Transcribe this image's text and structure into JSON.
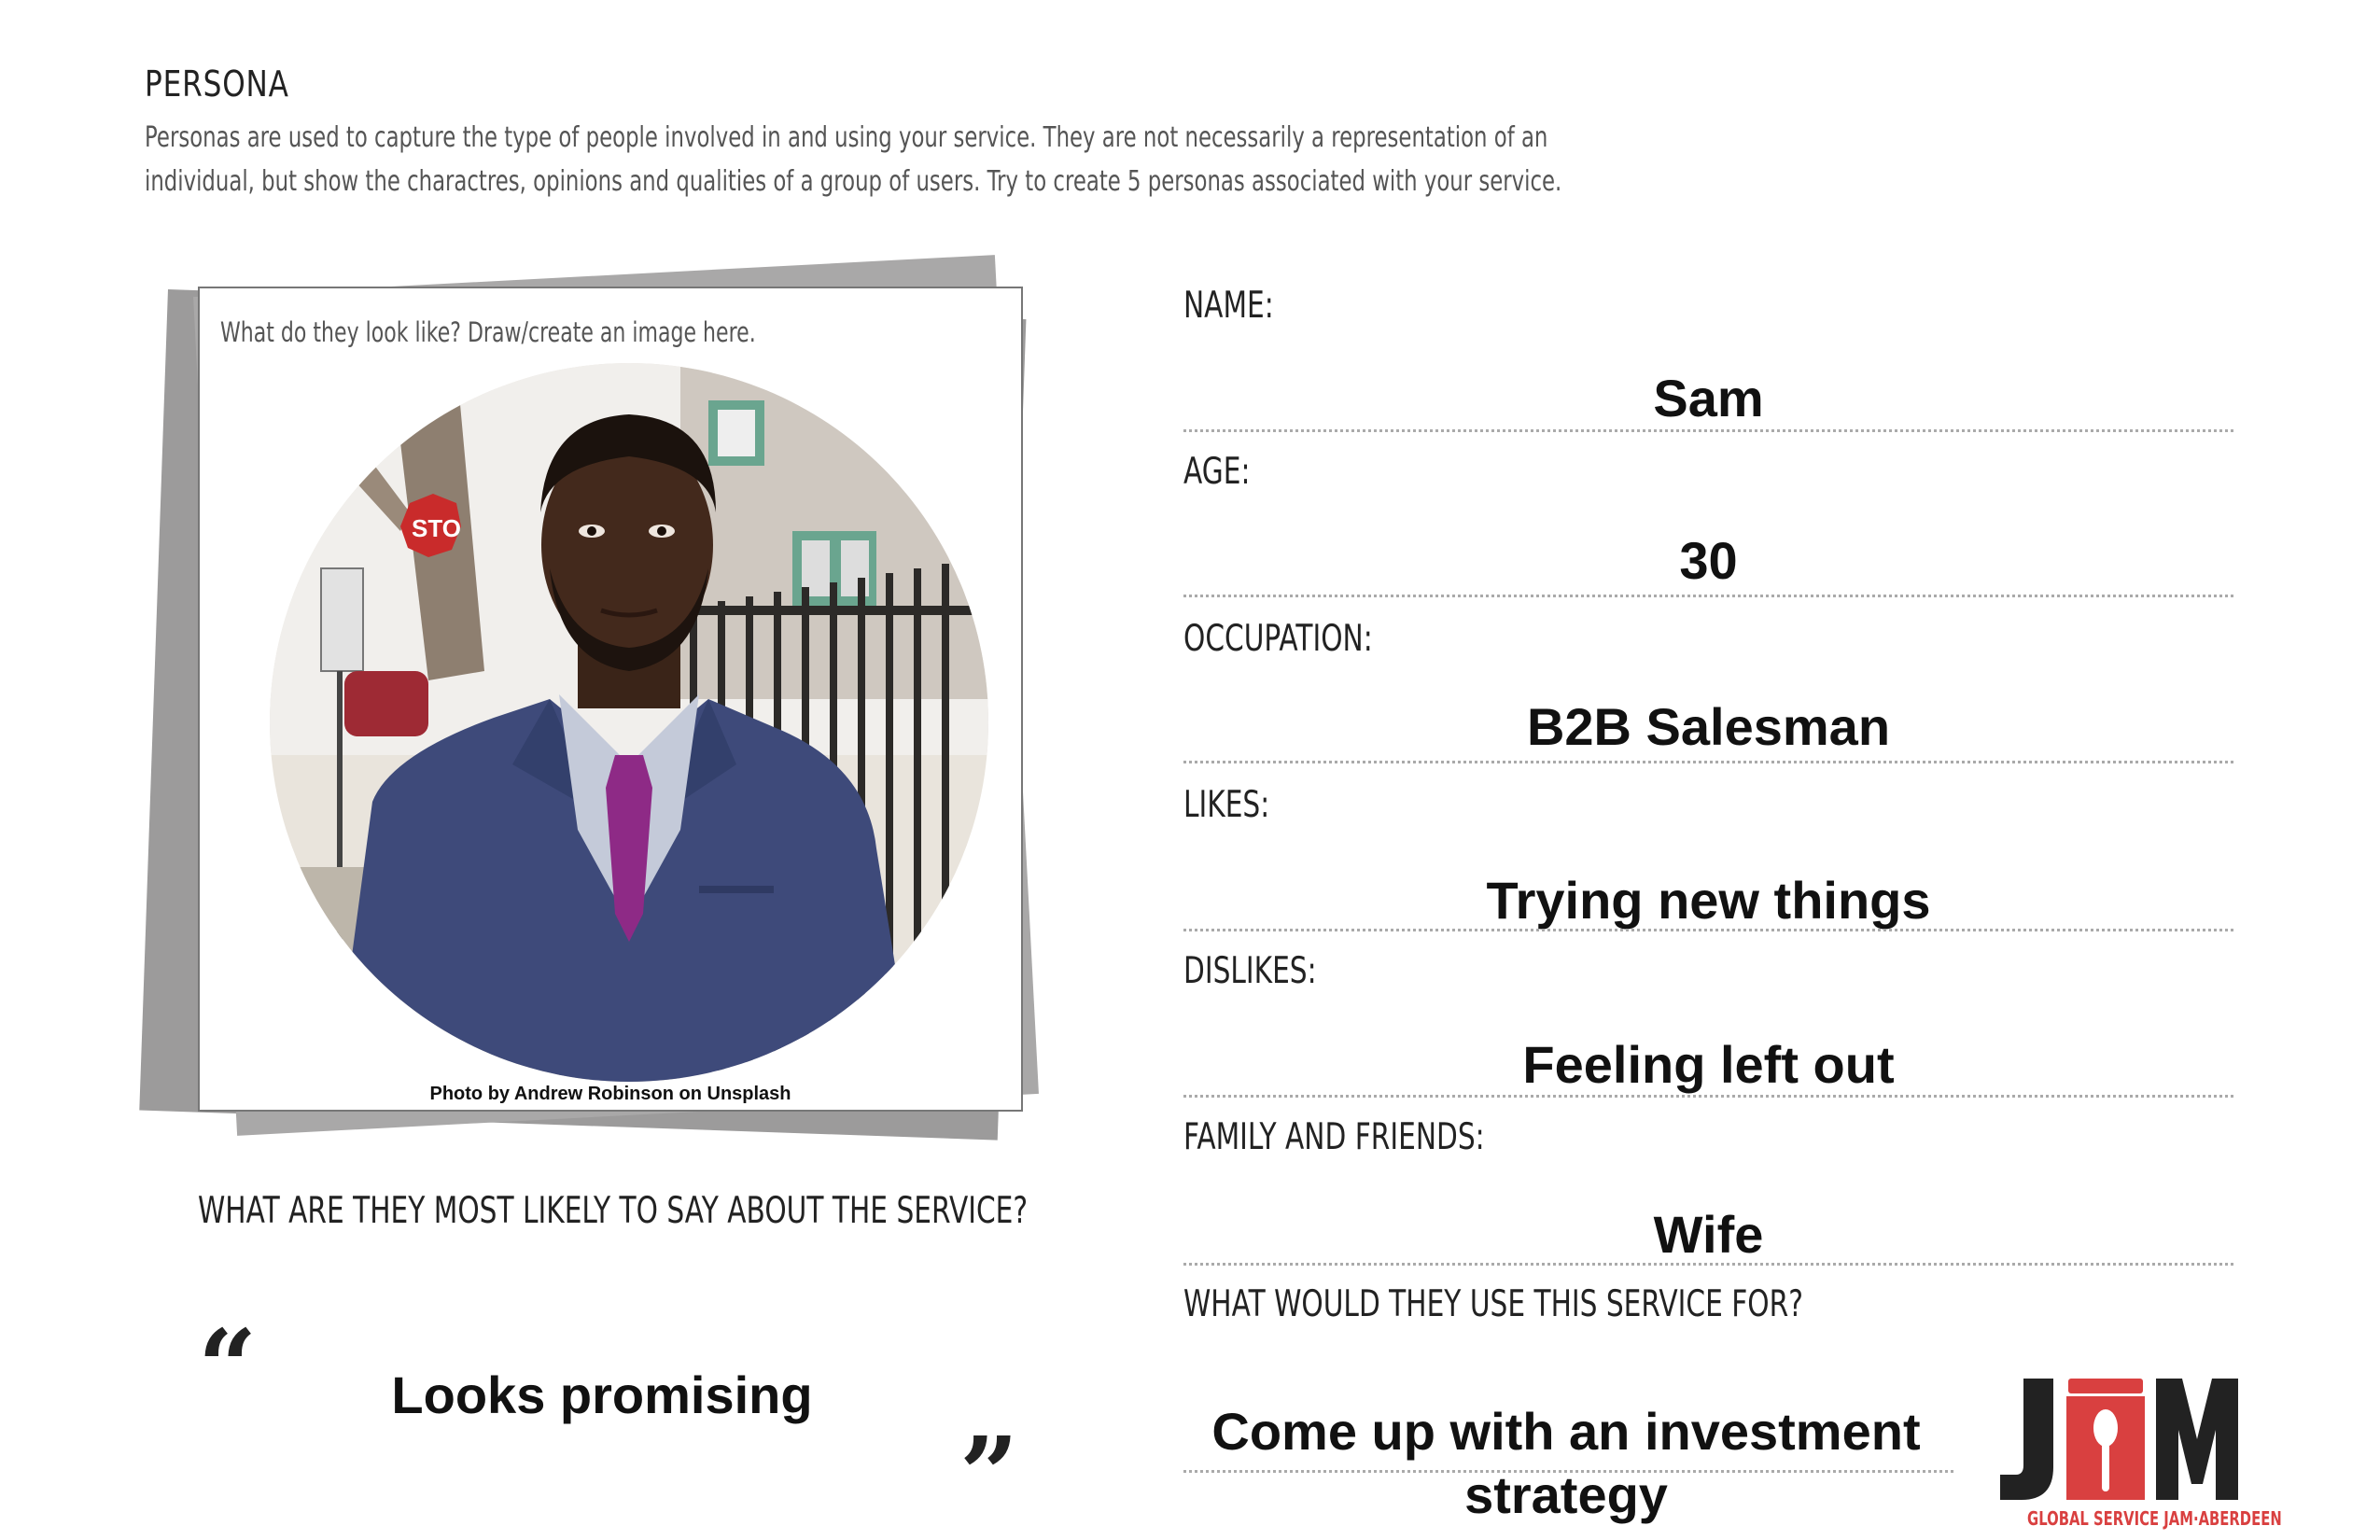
{
  "header": {
    "title": "PERSONA",
    "intro_line1": "Personas are used to capture the type of people involved in and using your service. They are not necessarily a representation of an",
    "intro_line2": "individual, but show the charactres, opinions and qualities of a group of users. Try to create 5 personas associated with your service."
  },
  "photo_card": {
    "prompt": "What do they look like? Draw/create an image here.",
    "credit": "Photo by Andrew Robinson on Unsplash"
  },
  "say": {
    "label": "WHAT ARE THEY MOST LIKELY TO SAY ABOUT THE SERVICE?",
    "open_quote": "“",
    "close_quote": "”",
    "answer": "Looks promising"
  },
  "fields": {
    "name": {
      "label": "NAME:",
      "value": "Sam"
    },
    "age": {
      "label": "AGE:",
      "value": "30"
    },
    "occupation": {
      "label": "OCCUPATION:",
      "value": "B2B Salesman"
    },
    "likes": {
      "label": "LIKES:",
      "value": "Trying new things"
    },
    "dislikes": {
      "label": "DISLIKES:",
      "value": "Feeling left out"
    },
    "family": {
      "label": "FAMILY AND FRIENDS:",
      "value": "Wife"
    },
    "use": {
      "label": "WHAT WOULD THEY USE THIS SERVICE FOR?",
      "value": "Come up with an investment strategy"
    }
  },
  "logo": {
    "letters": "JAM",
    "subtitle": "GLOBAL SERVICE JAM·ABERDEEN",
    "color_red": "#d94040",
    "color_dark": "#222222"
  }
}
